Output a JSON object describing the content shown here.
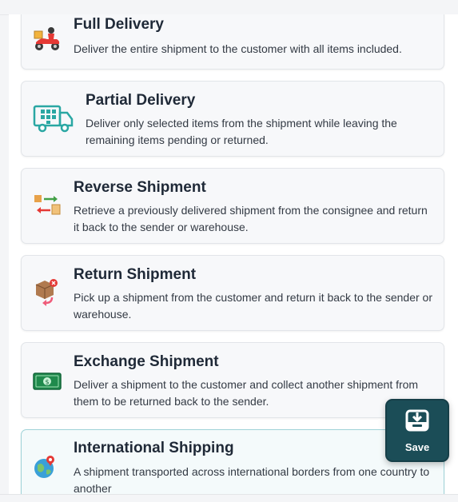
{
  "options": [
    {
      "title": "Full Delivery",
      "desc": "Deliver the entire shipment to the customer with all items included.",
      "icon": "delivery-scooter-icon"
    },
    {
      "title": "Partial Delivery",
      "desc": "Deliver only selected items from the shipment while leaving the remaining items pending or returned.",
      "icon": "delivery-truck-icon"
    },
    {
      "title": "Reverse Shipment",
      "desc": "Retrieve a previously delivered shipment from the consignee and return it back to the sender or warehouse.",
      "icon": "reverse-arrows-boxes-icon"
    },
    {
      "title": "Return Shipment",
      "desc": "Pick up a shipment from the customer and return it back to the sender or warehouse.",
      "icon": "return-box-icon"
    },
    {
      "title": "Exchange Shipment",
      "desc": "Deliver a shipment to the customer and collect another shipment from them to be returned back to the sender.",
      "icon": "cash-bill-icon"
    },
    {
      "title": "International Shipping",
      "desc": "A shipment transported across international borders from one country to another",
      "icon": "globe-pin-icon"
    }
  ],
  "save": {
    "label": "Save",
    "icon": "save-tray-icon"
  },
  "colors": {
    "accent": "#1b4d57",
    "selected_border": "#9fd3d8",
    "card_bg": "#f7f8fa"
  }
}
